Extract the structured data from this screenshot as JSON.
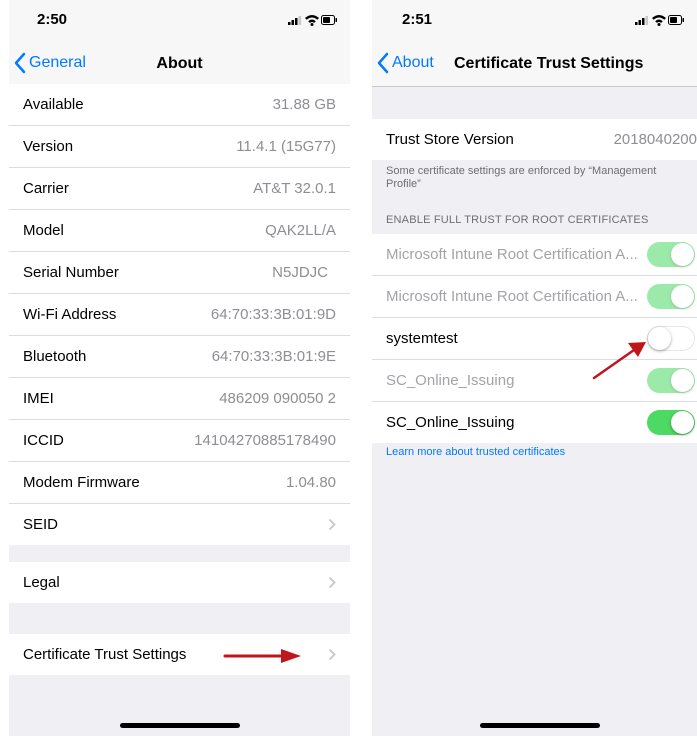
{
  "left": {
    "status_time": "2:50",
    "back_label": "General",
    "title": "About",
    "rows": [
      {
        "label": "Available",
        "value": "31.88 GB"
      },
      {
        "label": "Version",
        "value": "11.4.1 (15G77)"
      },
      {
        "label": "Carrier",
        "value": "AT&T 32.0.1"
      },
      {
        "label": "Model",
        "value": "QAK2LL/A"
      },
      {
        "label": "Serial Number",
        "value": "N5JDJC"
      },
      {
        "label": "Wi-Fi Address",
        "value": "64:70:33:3B:01:9D"
      },
      {
        "label": "Bluetooth",
        "value": "64:70:33:3B:01:9E"
      },
      {
        "label": "IMEI",
        "value": "486209 090050 2"
      },
      {
        "label": "ICCID",
        "value": "14104270885178490"
      },
      {
        "label": "Modem Firmware",
        "value": "1.04.80"
      },
      {
        "label": "SEID",
        "value": ""
      }
    ],
    "legal_label": "Legal",
    "cert_trust_label": "Certificate Trust Settings"
  },
  "right": {
    "status_time": "2:51",
    "back_label": "About",
    "title": "Certificate Trust Settings",
    "trust_store_label": "Trust Store Version",
    "trust_store_value": "2018040200",
    "enforced_note": "Some certificate settings are enforced by “Management Profile”",
    "section_header": "ENABLE FULL TRUST FOR ROOT CERTIFICATES",
    "certs": [
      {
        "label": "Microsoft Intune Root Certification A...",
        "enabled": true,
        "managed": true
      },
      {
        "label": "Microsoft Intune Root Certification A...",
        "enabled": true,
        "managed": true
      },
      {
        "label": "systemtest",
        "enabled": false,
        "managed": false
      },
      {
        "label": "SC_Online_Issuing",
        "enabled": true,
        "managed": true
      },
      {
        "label": "SC_Online_Issuing",
        "enabled": true,
        "managed": false
      }
    ],
    "learn_more_link": "Learn more about trusted certificates"
  },
  "colors": {
    "ios_blue": "#007aff",
    "toggle_green": "#4cd964",
    "arrow_red": "#c0161b",
    "grouped_background": "#efeff4"
  },
  "icons": [
    "signal-icon",
    "wifi-icon",
    "battery-icon",
    "back-chevron-icon",
    "disclosure-chevron-icon",
    "annotation-arrow"
  ]
}
